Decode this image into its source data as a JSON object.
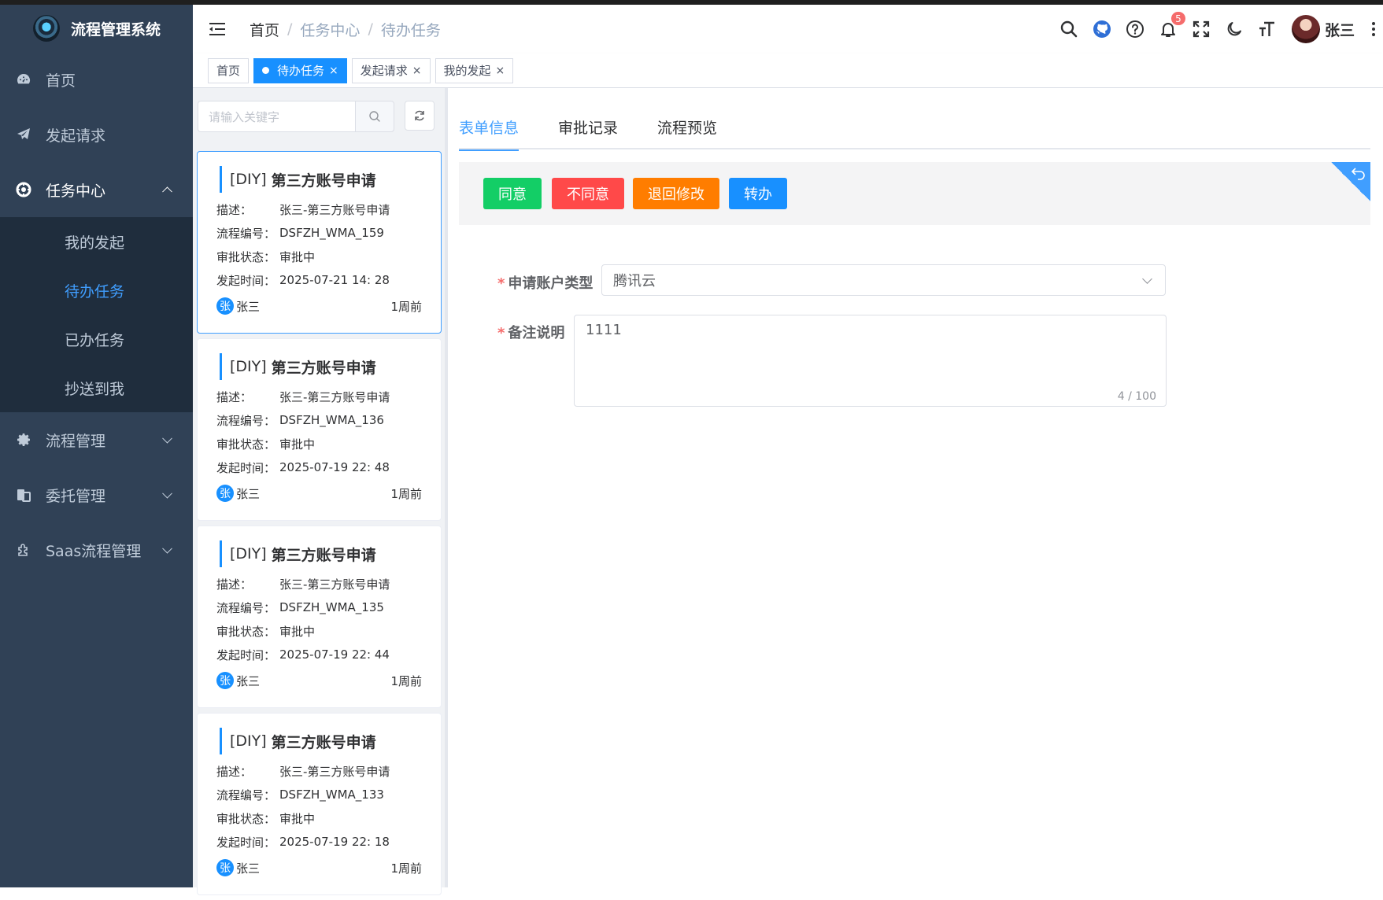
{
  "app": {
    "title": "流程管理系统"
  },
  "sidebar": {
    "items": [
      {
        "label": "首页",
        "icon": "dashboard-icon"
      },
      {
        "label": "发起请求",
        "icon": "paper-plane-icon"
      },
      {
        "label": "任务中心",
        "icon": "task-center-icon",
        "open": true,
        "children": [
          {
            "label": "我的发起"
          },
          {
            "label": "待办任务",
            "active": true
          },
          {
            "label": "已办任务"
          },
          {
            "label": "抄送到我"
          }
        ]
      },
      {
        "label": "流程管理",
        "icon": "gear-icon"
      },
      {
        "label": "委托管理",
        "icon": "delegate-icon"
      },
      {
        "label": "Saas流程管理",
        "icon": "puzzle-icon"
      }
    ]
  },
  "navbar": {
    "breadcrumb": [
      "首页",
      "任务中心",
      "待办任务"
    ],
    "breadcrumb_sep": "/",
    "notification_count": "5",
    "username": "张三"
  },
  "tags": [
    {
      "label": "首页",
      "active": false,
      "closable": false
    },
    {
      "label": "待办任务",
      "active": true,
      "closable": true
    },
    {
      "label": "发起请求",
      "active": false,
      "closable": true
    },
    {
      "label": "我的发起",
      "active": false,
      "closable": true
    }
  ],
  "tag_close": "×",
  "search": {
    "placeholder": "请输入关键字"
  },
  "task_labels": {
    "desc": "描述：",
    "code": "流程编号：",
    "status": "审批状态：",
    "time": "发起时间："
  },
  "tasks": [
    {
      "prefix": "[DIY]",
      "title": "第三方账号申请",
      "desc": "张三-第三方账号申请",
      "code": "DSFZH_WMA_159",
      "status": "审批中",
      "time": "2025-07-21 14: 28",
      "avatar": "张",
      "user": "张三",
      "ago": "1周前"
    },
    {
      "prefix": "[DIY]",
      "title": "第三方账号申请",
      "desc": "张三-第三方账号申请",
      "code": "DSFZH_WMA_136",
      "status": "审批中",
      "time": "2025-07-19 22: 48",
      "avatar": "张",
      "user": "张三",
      "ago": "1周前"
    },
    {
      "prefix": "[DIY]",
      "title": "第三方账号申请",
      "desc": "张三-第三方账号申请",
      "code": "DSFZH_WMA_135",
      "status": "审批中",
      "time": "2025-07-19 22: 44",
      "avatar": "张",
      "user": "张三",
      "ago": "1周前"
    },
    {
      "prefix": "[DIY]",
      "title": "第三方账号申请",
      "desc": "张三-第三方账号申请",
      "code": "DSFZH_WMA_133",
      "status": "审批中",
      "time": "2025-07-19 22: 18",
      "avatar": "张",
      "user": "张三",
      "ago": "1周前"
    }
  ],
  "detail": {
    "tabs": [
      {
        "label": "表单信息",
        "active": true
      },
      {
        "label": "审批记录",
        "active": false
      },
      {
        "label": "流程预览",
        "active": false
      }
    ],
    "actions": [
      {
        "label": "同意",
        "color": "#13ce66"
      },
      {
        "label": "不同意",
        "color": "#ff4949"
      },
      {
        "label": "退回修改",
        "color": "#ff7d00"
      },
      {
        "label": "转办",
        "color": "#1890ff"
      }
    ],
    "form": {
      "account_type": {
        "required_mark": "*",
        "label": "申请账户类型",
        "value": "腾讯云"
      },
      "remark": {
        "required_mark": "*",
        "label": "备注说明",
        "value": "1111",
        "counter": "4 / 100"
      }
    }
  },
  "colors": {
    "sidebar_bg": "#304156",
    "submenu_bg": "#1f2d3d",
    "primary": "#409eff",
    "tag_active": "#1890ff"
  }
}
